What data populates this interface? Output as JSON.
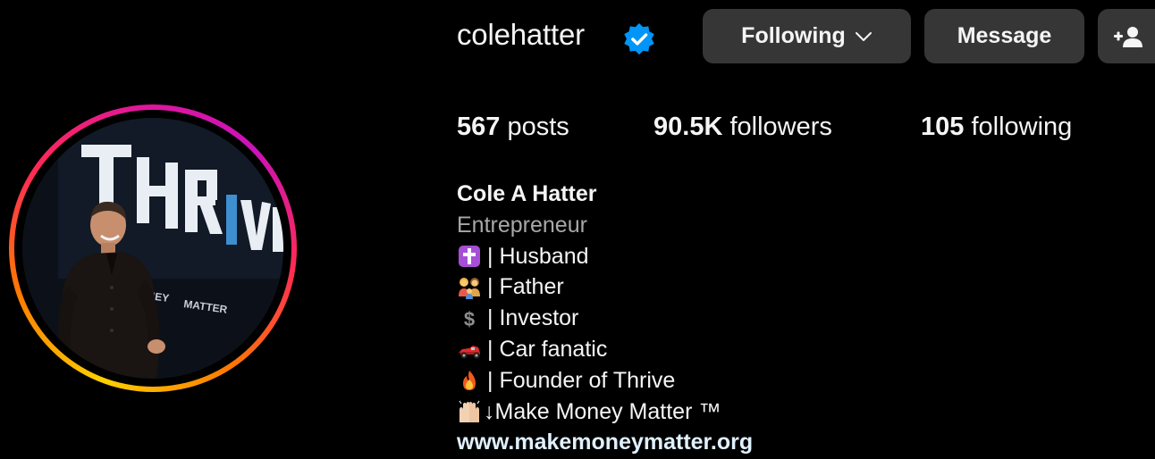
{
  "profile": {
    "username": "colehatter",
    "verified_icon": "verified-badge-icon"
  },
  "actions": {
    "following_label": "Following",
    "message_label": "Message",
    "add_user_icon": "add-user-icon"
  },
  "stats": {
    "posts_count": "567",
    "posts_label": "posts",
    "followers_count": "90.5K",
    "followers_label": "followers",
    "following_count": "105",
    "following_label": "following"
  },
  "bio": {
    "name": "Cole A Hatter",
    "category": "Entrepreneur",
    "lines": [
      {
        "icon": "cross-icon",
        "text": "| Husband"
      },
      {
        "icon": "family-icon",
        "text": "| Father"
      },
      {
        "icon": "dollar-icon",
        "text": "| Investor"
      },
      {
        "icon": "race-car-icon",
        "text": "| Car fanatic"
      },
      {
        "icon": "fire-icon",
        "text": "| Founder of Thrive"
      },
      {
        "icon": "raised-hands-icon",
        "text": "↓Make Money Matter ™"
      }
    ],
    "website": "www.makemoneymatter.org"
  },
  "avatar": {
    "image_text": "THRIVE",
    "image_subtext": "MONEY MATTER"
  },
  "colors": {
    "background": "#000000",
    "button": "#363636",
    "secondary_text": "#a8a8a8",
    "link": "#e0f1ff",
    "verified": "#0095f6"
  }
}
